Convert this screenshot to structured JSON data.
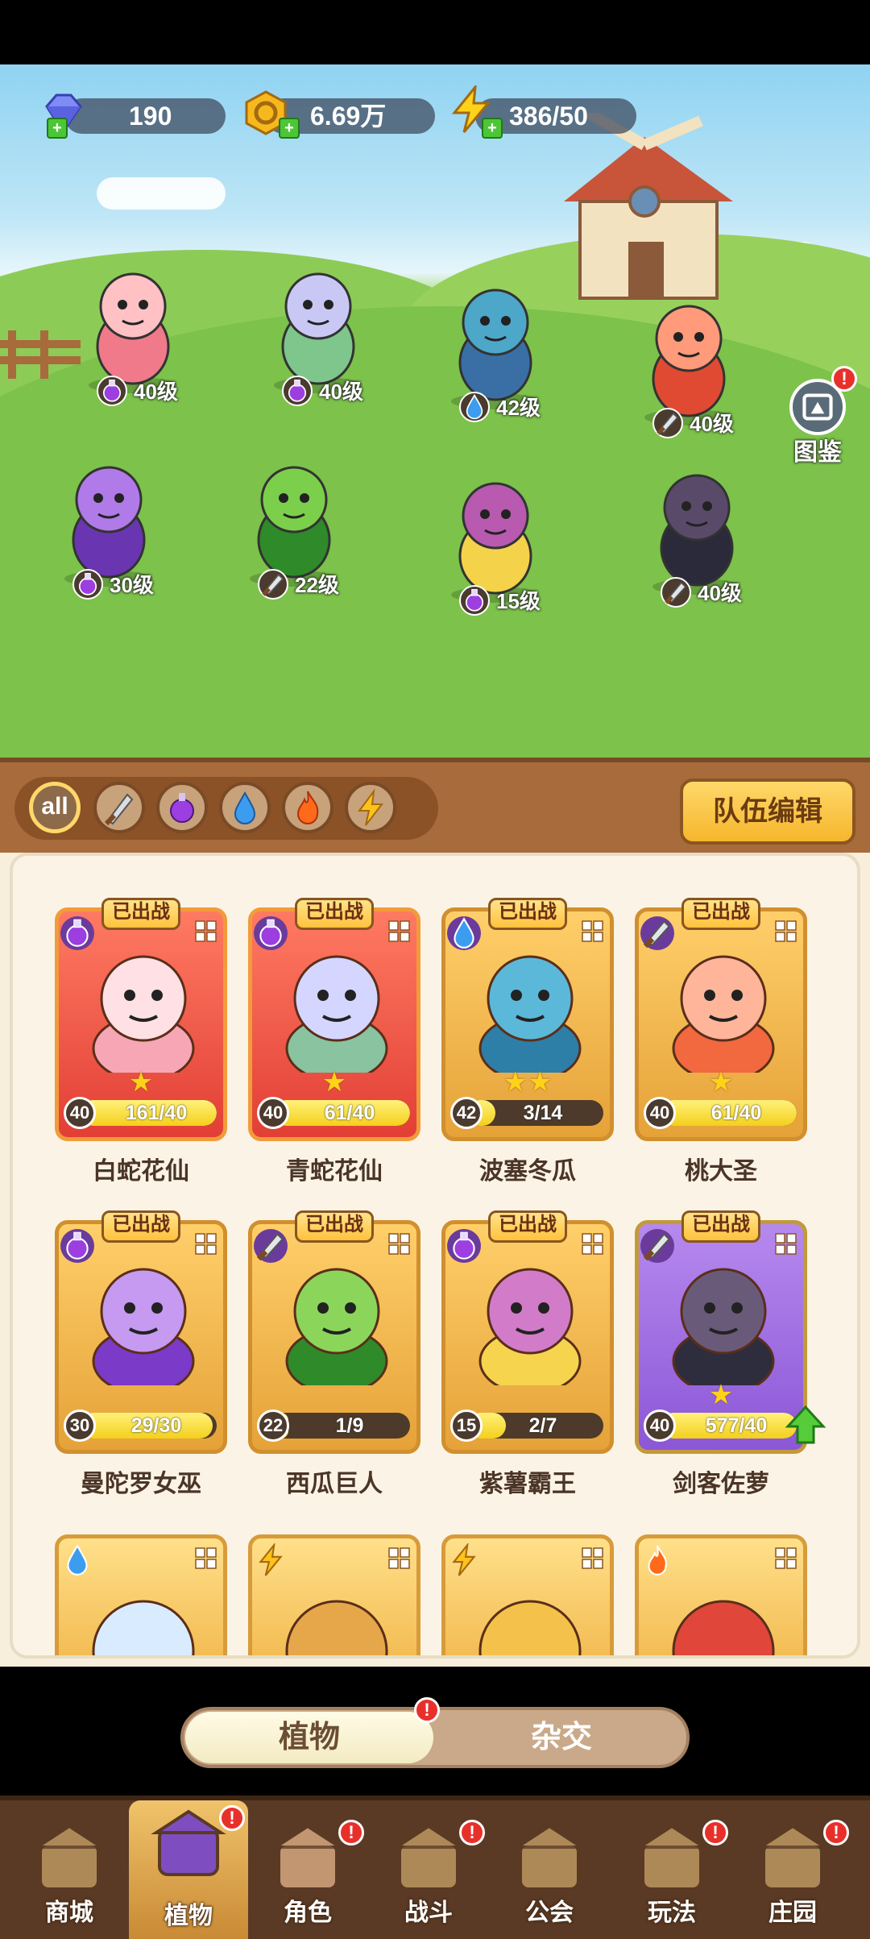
{
  "resources": {
    "gems": "190",
    "coins": "6.69万",
    "energy": "386/50"
  },
  "gallery_label": "图鉴",
  "scene_heroes": [
    {
      "level": "40级",
      "type": "potion"
    },
    {
      "level": "40级",
      "type": "potion"
    },
    {
      "level": "42级",
      "type": "water"
    },
    {
      "level": "40级",
      "type": "sword"
    },
    {
      "level": "30级",
      "type": "potion"
    },
    {
      "level": "22级",
      "type": "sword"
    },
    {
      "level": "15级",
      "type": "potion"
    },
    {
      "level": "40级",
      "type": "sword"
    }
  ],
  "filters": [
    "all",
    "sword",
    "potion",
    "water",
    "fire",
    "lightning"
  ],
  "team_edit_label": "队伍编辑",
  "deployed_label": "已出战",
  "cards": [
    {
      "name": "白蛇花仙",
      "level": "40",
      "progress_text": "161/40",
      "progress": 1.0,
      "stars": "★",
      "type": "potion",
      "style": "red"
    },
    {
      "name": "青蛇花仙",
      "level": "40",
      "progress_text": "61/40",
      "progress": 1.0,
      "stars": "★",
      "type": "potion",
      "style": "red"
    },
    {
      "name": "波塞冬瓜",
      "level": "42",
      "progress_text": "3/14",
      "progress": 0.21,
      "stars": "★★",
      "type": "water",
      "style": "gold"
    },
    {
      "name": "桃大圣",
      "level": "40",
      "progress_text": "61/40",
      "progress": 1.0,
      "stars": "★",
      "type": "sword",
      "style": "gold"
    },
    {
      "name": "曼陀罗女巫",
      "level": "30",
      "progress_text": "29/30",
      "progress": 0.97,
      "stars": "",
      "type": "potion",
      "style": "gold"
    },
    {
      "name": "西瓜巨人",
      "level": "22",
      "progress_text": "1/9",
      "progress": 0.11,
      "stars": "",
      "type": "sword",
      "style": "gold"
    },
    {
      "name": "紫薯霸王",
      "level": "15",
      "progress_text": "2/7",
      "progress": 0.29,
      "stars": "",
      "type": "potion",
      "style": "gold"
    },
    {
      "name": "剑客佐萝",
      "level": "40",
      "progress_text": "577/40",
      "progress": 1.0,
      "stars": "★",
      "type": "sword",
      "style": "purple"
    }
  ],
  "partial_cards": [
    {
      "type": "water"
    },
    {
      "type": "lightning"
    },
    {
      "type": "lightning"
    },
    {
      "type": "fire"
    }
  ],
  "toggle": {
    "left": "植物",
    "right": "杂交"
  },
  "nav": [
    {
      "label": "商城",
      "icon": "shop-icon",
      "badge": false
    },
    {
      "label": "植物",
      "icon": "plants-icon",
      "badge": true,
      "active": true
    },
    {
      "label": "角色",
      "icon": "character-icon",
      "badge": true
    },
    {
      "label": "战斗",
      "icon": "battle-icon",
      "badge": true
    },
    {
      "label": "公会",
      "icon": "guild-icon",
      "badge": false
    },
    {
      "label": "玩法",
      "icon": "gameplay-icon",
      "badge": true
    },
    {
      "label": "庄园",
      "icon": "manor-icon",
      "badge": true
    }
  ],
  "badge_mark": "!",
  "colors": {
    "accent": "#f6b62c",
    "wood": "#a86b3c",
    "panel": "#fbf4e6",
    "badge": "#e8302b"
  }
}
